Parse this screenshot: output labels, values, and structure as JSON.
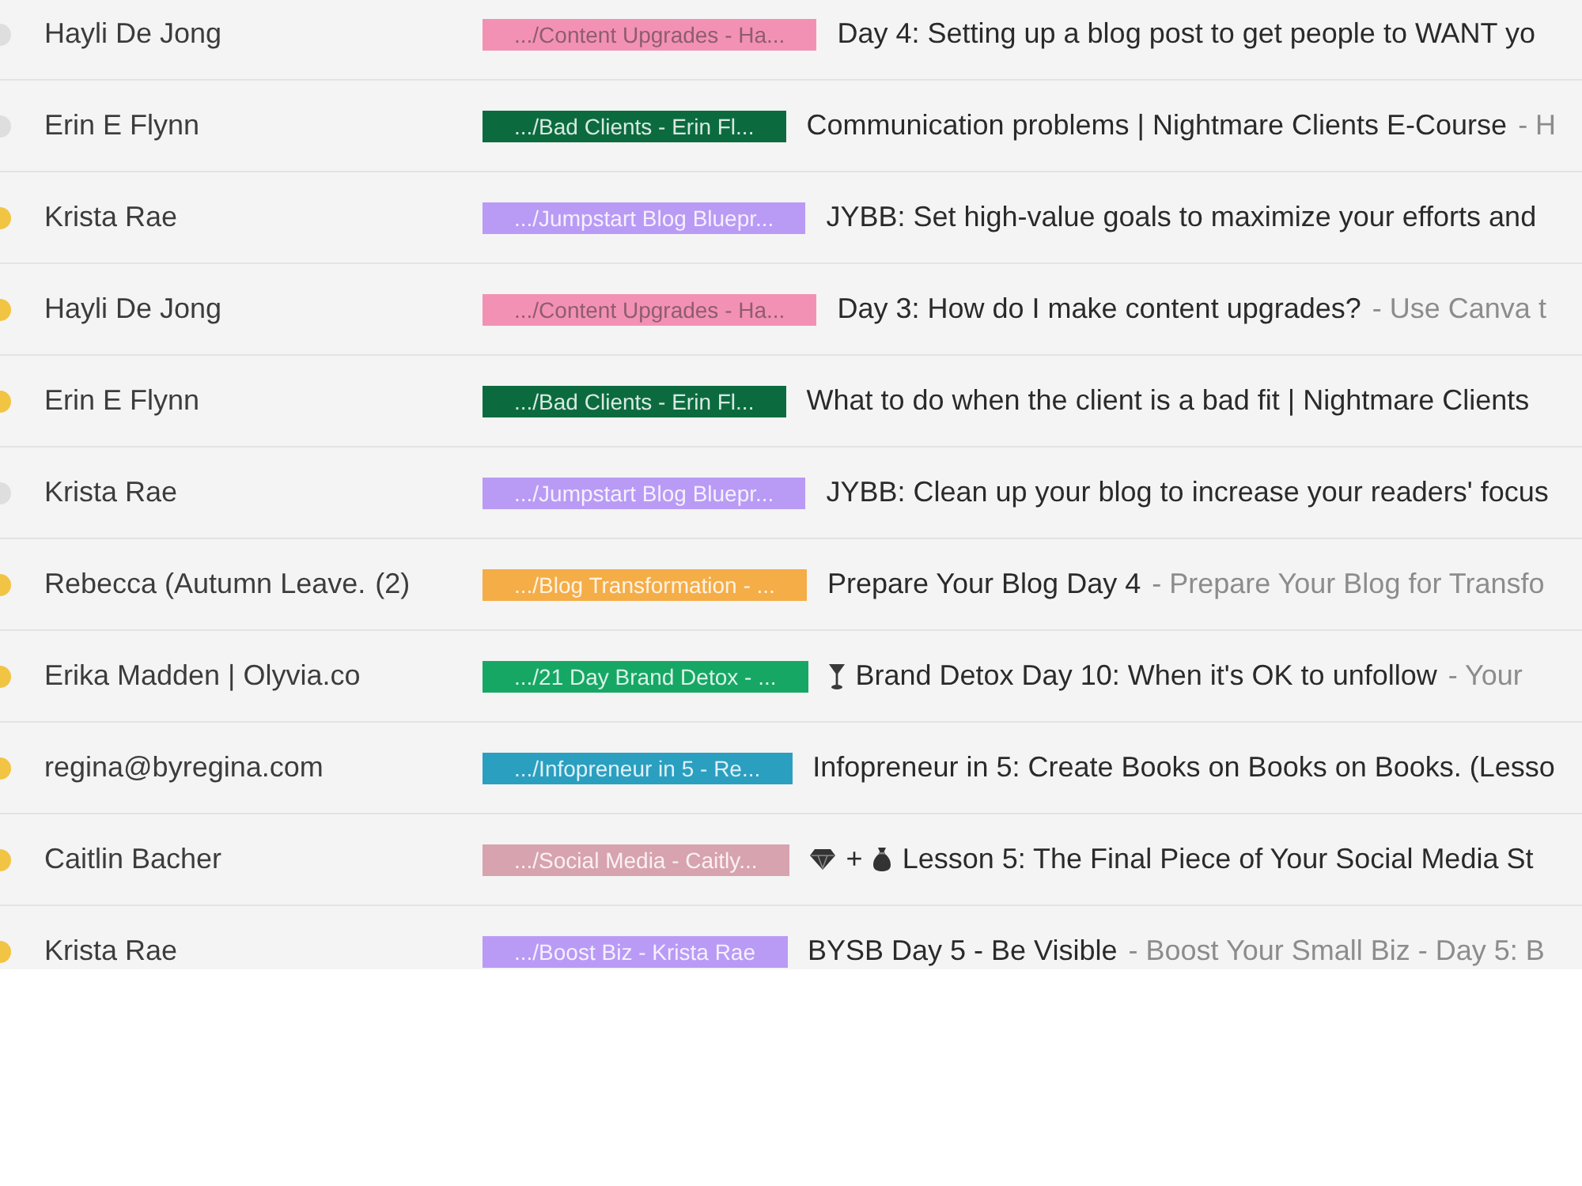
{
  "emails": [
    {
      "important": false,
      "sender": "Hayli De Jong",
      "label": {
        "text": ".../Content Upgrades - Ha...",
        "color": "#f391b4",
        "dark_text": true
      },
      "subject": "Day 4: Setting up a blog post to get people to WANT yo"
    },
    {
      "important": false,
      "sender": "Erin E Flynn",
      "label": {
        "text": ".../Bad Clients - Erin Fl...",
        "color": "#0b6b3f",
        "dark_text": false
      },
      "subject": "Communication problems | Nightmare Clients E-Course",
      "snippet": "- H"
    },
    {
      "important": true,
      "sender": "Krista Rae",
      "label": {
        "text": ".../Jumpstart Blog Bluepr...",
        "color": "#b99bf5",
        "dark_text": false
      },
      "subject": "JYBB: Set high-value goals to maximize your efforts and"
    },
    {
      "important": true,
      "sender": "Hayli De Jong",
      "label": {
        "text": ".../Content Upgrades - Ha...",
        "color": "#f391b4",
        "dark_text": true
      },
      "subject": "Day 3: How do I make content upgrades?",
      "snippet": "- Use Canva t"
    },
    {
      "important": true,
      "sender": "Erin E Flynn",
      "label": {
        "text": ".../Bad Clients - Erin Fl...",
        "color": "#0b6b3f",
        "dark_text": false
      },
      "subject": "What to do when the client is a bad fit | Nightmare Clients"
    },
    {
      "important": false,
      "sender": "Krista Rae",
      "label": {
        "text": ".../Jumpstart Blog Bluepr...",
        "color": "#b99bf5",
        "dark_text": false
      },
      "subject": "JYBB: Clean up your blog to increase your readers' focus"
    },
    {
      "important": true,
      "sender": "Rebecca (Autumn Leave.",
      "count": "(2)",
      "label": {
        "text": ".../Blog Transformation - ...",
        "color": "#f5ad47",
        "dark_text": false
      },
      "subject": "Prepare Your Blog Day 4",
      "snippet": "- Prepare Your Blog for Transfo"
    },
    {
      "important": true,
      "sender": "Erika Madden | Olyvia.co",
      "label": {
        "text": ".../21 Day Brand Detox - ...",
        "color": "#16a765",
        "dark_text": false
      },
      "subject_prefix": [
        {
          "kind": "glass"
        }
      ],
      "subject": "Brand Detox Day 10: When it's OK to unfollow",
      "snippet": "- Your"
    },
    {
      "important": true,
      "sender": "regina@byregina.com",
      "label": {
        "text": ".../Infopreneur in 5 - Re...",
        "color": "#2b9fc0",
        "dark_text": false
      },
      "subject": "Infopreneur in 5: Create Books on Books on Books. (Lesso"
    },
    {
      "important": true,
      "sender": "Caitlin Bacher",
      "label": {
        "text": ".../Social Media - Caitly...",
        "color": "#d7a3af",
        "dark_text": false
      },
      "subject_prefix": [
        {
          "kind": "gem"
        },
        {
          "kind": "text",
          "text": "+"
        },
        {
          "kind": "bag"
        }
      ],
      "subject": "Lesson 5: The Final Piece of Your Social Media St"
    },
    {
      "important": true,
      "sender": "Krista Rae",
      "label": {
        "text": ".../Boost Biz - Krista Rae",
        "color": "#b99bf5",
        "dark_text": false
      },
      "subject": "BYSB Day 5 - Be Visible",
      "snippet": "- Boost Your Small Biz - Day 5: B"
    }
  ]
}
